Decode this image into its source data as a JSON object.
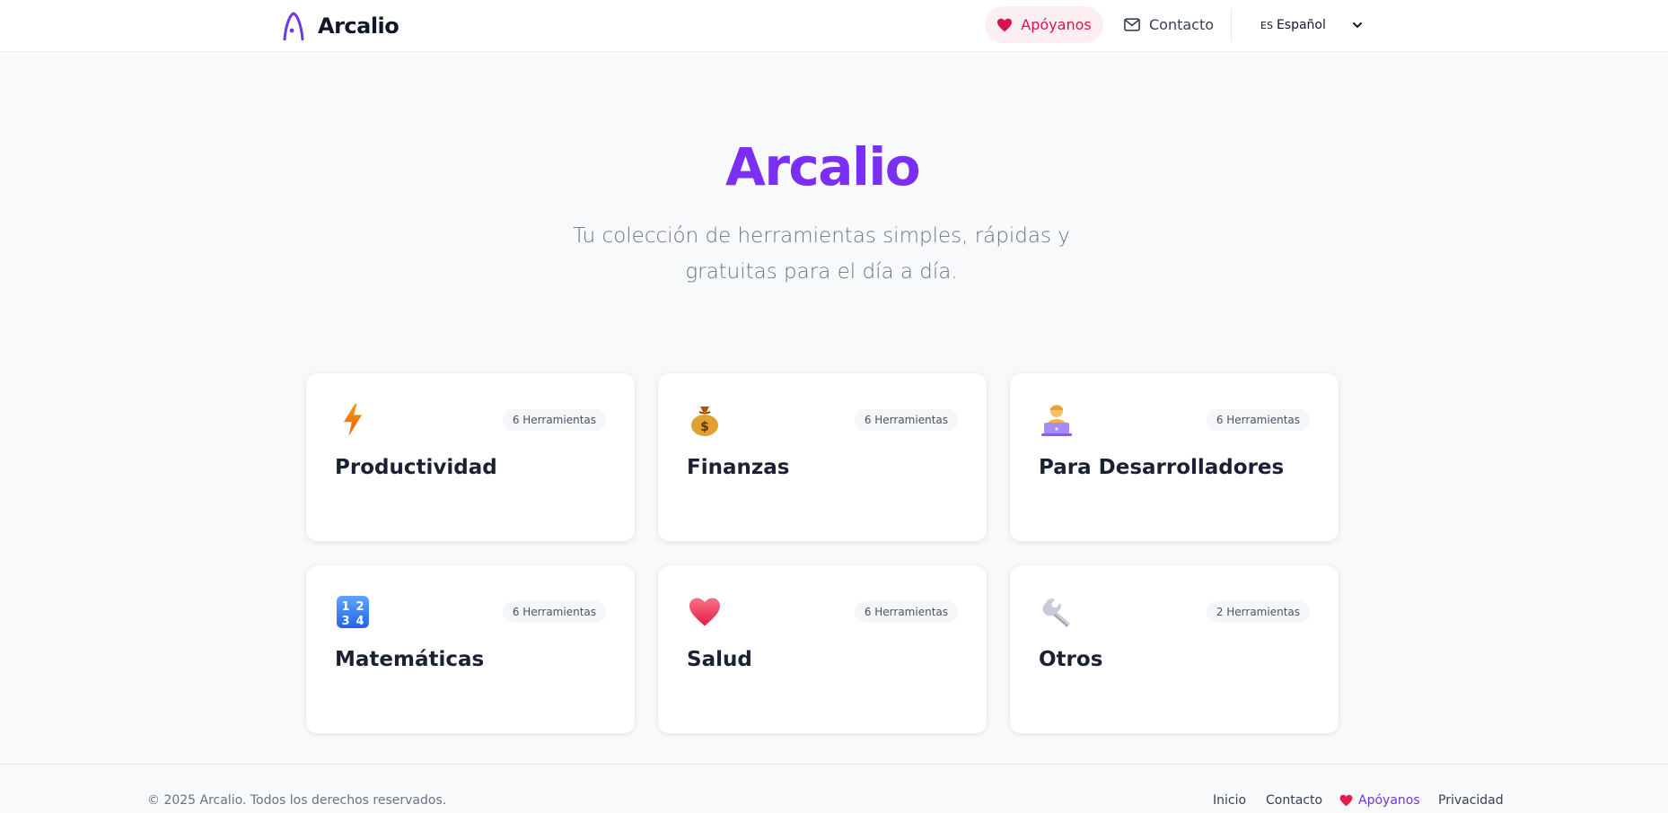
{
  "header": {
    "brand": "Arcalio",
    "support_label": "Apóyanos",
    "contact_label": "Contacto",
    "language": {
      "code": "ES",
      "label": "Español"
    }
  },
  "hero": {
    "title": "Arcalio",
    "subtitle": "Tu colección de herramientas simples, rápidas y gratuitas para el día a día."
  },
  "categories": [
    {
      "title": "Productividad",
      "badge": "6 Herramientas",
      "icon": "lightning-icon"
    },
    {
      "title": "Finanzas",
      "badge": "6 Herramientas",
      "icon": "money-bag-icon"
    },
    {
      "title": "Para Desarrolladores",
      "badge": "6 Herramientas",
      "icon": "developer-icon"
    },
    {
      "title": "Matemáticas",
      "badge": "6 Herramientas",
      "icon": "numbers-icon"
    },
    {
      "title": "Salud",
      "badge": "6 Herramientas",
      "icon": "heart-icon"
    },
    {
      "title": "Otros",
      "badge": "2 Herramientas",
      "icon": "wrench-icon"
    }
  ],
  "footer": {
    "copyright": "© 2025 Arcalio. Todos los derechos reservados.",
    "links": {
      "home": "Inicio",
      "contact": "Contacto",
      "support": "Apóyanos",
      "privacy": "Privacidad"
    }
  },
  "colors": {
    "brand": "#7b2ff2",
    "support": "#d9134f",
    "support_bg": "#fdeef2",
    "footer_support": "#6d35e6"
  }
}
